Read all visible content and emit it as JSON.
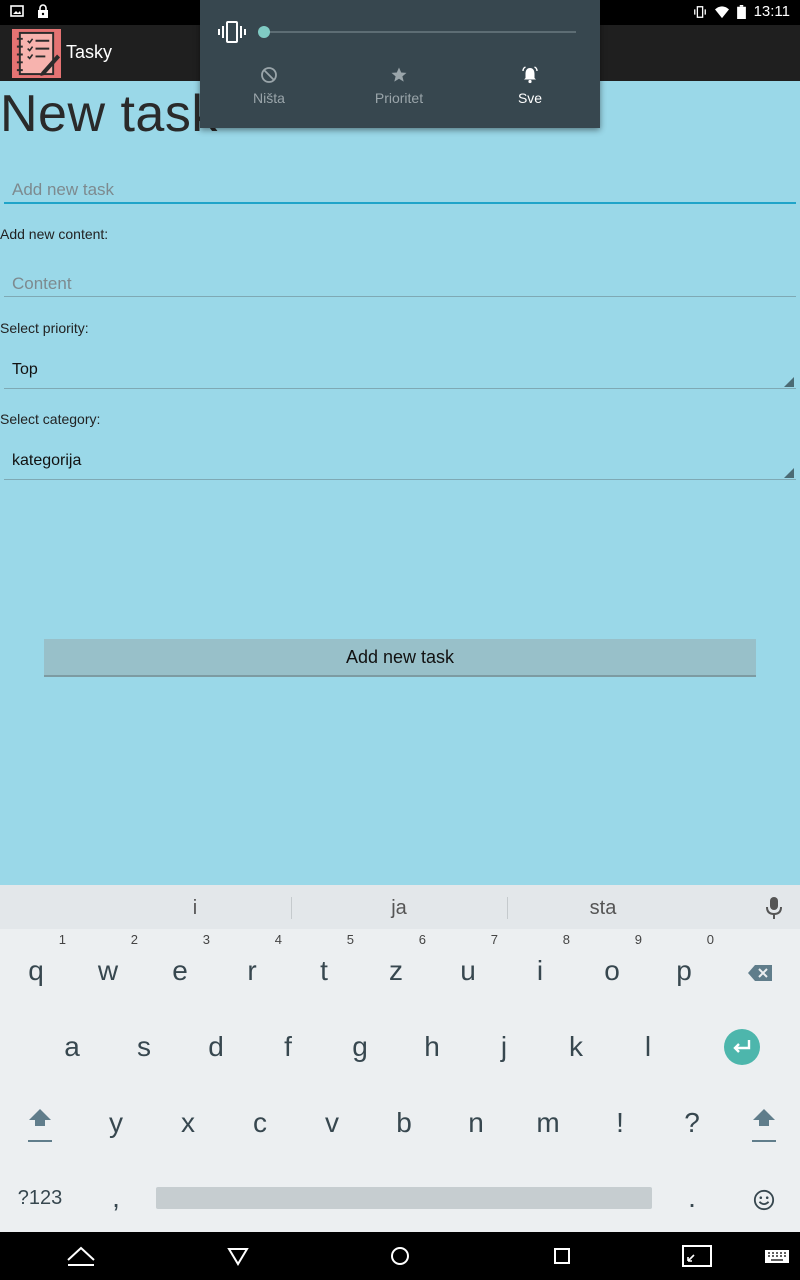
{
  "status_bar": {
    "time": "13:11",
    "icons": [
      "image-icon",
      "lock-icon",
      "vibrate-icon",
      "wifi-icon",
      "battery-icon"
    ]
  },
  "action_bar": {
    "app_title": "Tasky",
    "logo_icon": "notebook-checklist-icon"
  },
  "volume_panel": {
    "level": 0,
    "modes": [
      {
        "label": "Ništa",
        "icon": "block-icon",
        "active": false
      },
      {
        "label": "Prioritet",
        "icon": "star-icon",
        "active": false
      },
      {
        "label": "Sve",
        "icon": "bell-icon",
        "active": true
      }
    ],
    "accent": "#80cbc4"
  },
  "form": {
    "title": "New task",
    "task_placeholder": "Add new task",
    "content_label": "Add new content:",
    "content_placeholder": "Content",
    "priority_label": "Select priority:",
    "priority_value": "Top",
    "category_label": "Select category:",
    "category_value": "kategorija",
    "submit_label": "Add new task"
  },
  "keyboard": {
    "suggestions": [
      "i",
      "ja",
      "sta"
    ],
    "row1": [
      {
        "k": "q",
        "h": "1"
      },
      {
        "k": "w",
        "h": "2"
      },
      {
        "k": "e",
        "h": "3"
      },
      {
        "k": "r",
        "h": "4"
      },
      {
        "k": "t",
        "h": "5"
      },
      {
        "k": "z",
        "h": "6"
      },
      {
        "k": "u",
        "h": "7"
      },
      {
        "k": "i",
        "h": "8"
      },
      {
        "k": "o",
        "h": "9"
      },
      {
        "k": "p",
        "h": "0"
      }
    ],
    "row2": [
      "a",
      "s",
      "d",
      "f",
      "g",
      "h",
      "j",
      "k",
      "l"
    ],
    "row3": [
      "y",
      "x",
      "c",
      "v",
      "b",
      "n",
      "m",
      "!",
      "?"
    ],
    "symbols_label": "?123",
    "comma": ",",
    "period": "."
  },
  "colors": {
    "background": "#9ad8e8",
    "focus_underline": "#1fa4c9",
    "enter_key": "#4db6ac"
  }
}
